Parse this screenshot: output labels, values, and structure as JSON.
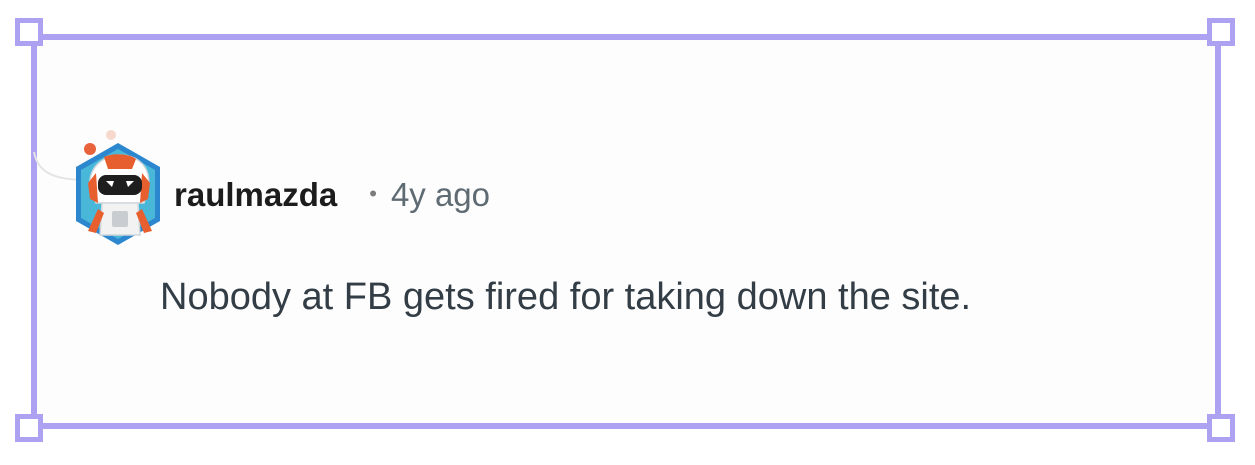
{
  "comment": {
    "author": "raulmazda",
    "separator": "•",
    "timestamp": "4y ago",
    "body": "Nobody at FB gets fired for taking down the site."
  },
  "avatar": {
    "icon": "robot-avatar-icon",
    "ring_color": "#3a92d9"
  },
  "selection": {
    "border_color": "#ada2f2"
  }
}
